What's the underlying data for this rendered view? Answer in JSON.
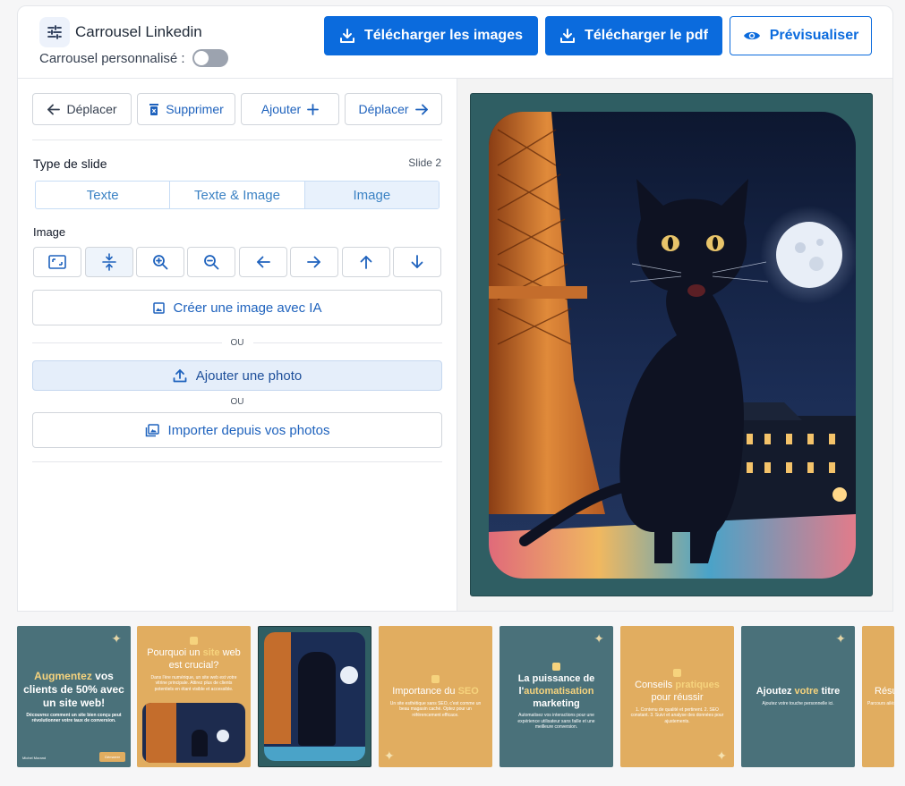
{
  "header": {
    "title": "Carrousel Linkedin",
    "custom_label": "Carrousel personnalisé :",
    "download_images": "Télécharger les images",
    "download_pdf": "Télécharger le pdf",
    "preview": "Prévisualiser"
  },
  "toolbar": {
    "move_left": "Déplacer",
    "delete": "Supprimer",
    "add": "Ajouter",
    "move_right": "Déplacer"
  },
  "slide": {
    "type_label": "Type de slide",
    "number": "Slide 2",
    "types": [
      "Texte",
      "Texte & Image",
      "Image"
    ],
    "selected_type": "Image"
  },
  "image_section": {
    "label": "Image",
    "tools": [
      "fit-icon",
      "center-icon",
      "zoom-in-icon",
      "zoom-out-icon",
      "arrow-left-icon",
      "arrow-right-icon",
      "arrow-up-icon",
      "arrow-down-icon"
    ],
    "create_ai": "Créer une image avec IA",
    "or1": "OU",
    "add_photo": "Ajouter une photo",
    "or2": "OU",
    "import": "Importer depuis vos photos"
  },
  "thumbnails": [
    {
      "title": "Augmentez vos clients de 50% avec un site web!",
      "highlight": "Augmentez",
      "sub": "Découvrez comment un site bien conçu peut révolutionner votre taux de conversion.",
      "button": "Démarrer",
      "footer": "Michel Morand"
    },
    {
      "title_pre": "Pourquoi un ",
      "highlight": "site",
      "title_post": " web est crucial?",
      "sub": "Dans l'ère numérique, un site web est votre vitrine principale. Attirez plus de clients potentiels en étant visible et accessible."
    },
    {
      "title": ""
    },
    {
      "title_pre": "Importance du ",
      "highlight": "SEO",
      "sub": "Un site esthétique sans SEO, c'est comme un beau magasin caché. Optez pour un référencement efficace."
    },
    {
      "title_pre": "La puissance de l'",
      "highlight": "automatisation",
      "title_post": " marketing",
      "sub": "Automatisez vos interactions pour une expérience utilisateur sans faille et une meilleure conversion."
    },
    {
      "title_pre": "Conseils ",
      "highlight": "pratiques",
      "title_post": " pour réussir",
      "sub": "1. Contenu de qualité et pertinent. 2. SEO constant. 3. Suivi et analyse des données pour ajustements."
    },
    {
      "title_pre": "Ajoutez ",
      "highlight": "votre",
      "title_post": " titre",
      "sub": "Ajoutez votre touche personnelle ici."
    },
    {
      "title": "Résu",
      "sub": "Parcours ailés pour..."
    }
  ],
  "colors": {
    "primary": "#0b6bdd",
    "teal": "#2f5e63",
    "thumb_teal": "#4a717a",
    "thumb_orange": "#e1ad60",
    "highlight_yellow": "#f6d37d"
  }
}
